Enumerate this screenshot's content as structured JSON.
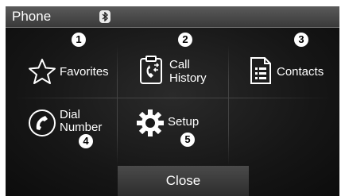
{
  "header": {
    "title": "Phone",
    "bluetooth_icon": "bluetooth-icon"
  },
  "menu": [
    {
      "id": "favorites",
      "label_lines": [
        "Favorites"
      ],
      "icon": "star-icon",
      "number": "1"
    },
    {
      "id": "call-history",
      "label_lines": [
        "Call",
        "History"
      ],
      "icon": "call-history-icon",
      "number": "2"
    },
    {
      "id": "contacts",
      "label_lines": [
        "Contacts"
      ],
      "icon": "contacts-icon",
      "number": "3"
    },
    {
      "id": "dial-number",
      "label_lines": [
        "Dial",
        "Number"
      ],
      "icon": "dial-icon",
      "number": "4"
    },
    {
      "id": "setup",
      "label_lines": [
        "Setup"
      ],
      "icon": "gear-icon",
      "number": "5"
    }
  ],
  "footer": {
    "close_label": "Close"
  }
}
